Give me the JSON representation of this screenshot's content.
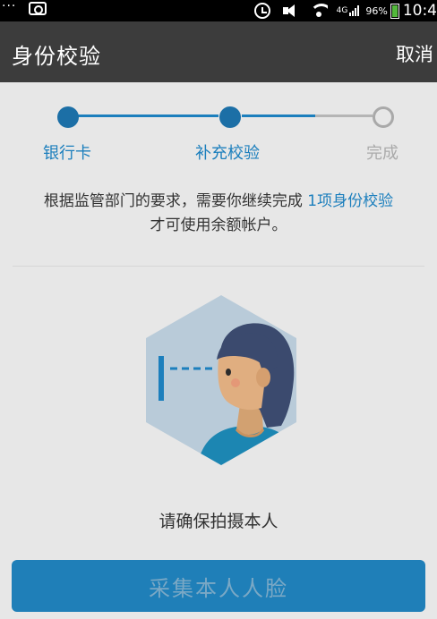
{
  "status_bar": {
    "dots": "···",
    "network": "4G",
    "battery": "96%",
    "time": "10:4"
  },
  "header": {
    "title": "身份校验",
    "cancel": "取消"
  },
  "stepper": {
    "steps": [
      {
        "label": "银行卡",
        "state": "done"
      },
      {
        "label": "补充校验",
        "state": "active"
      },
      {
        "label": "完成",
        "state": "pending"
      }
    ]
  },
  "intro": {
    "text_before": "根据监管部门的要求，需要你继续完成",
    "link": "1项身份校验",
    "text_after": "才可使用余额帐户。"
  },
  "face_note": "请确保拍摄本人",
  "collect_button": "采集本人人脸",
  "colors": {
    "accent": "#1c7fbd",
    "header_bg": "#3c3c3c",
    "background": "#e7e7e7"
  }
}
